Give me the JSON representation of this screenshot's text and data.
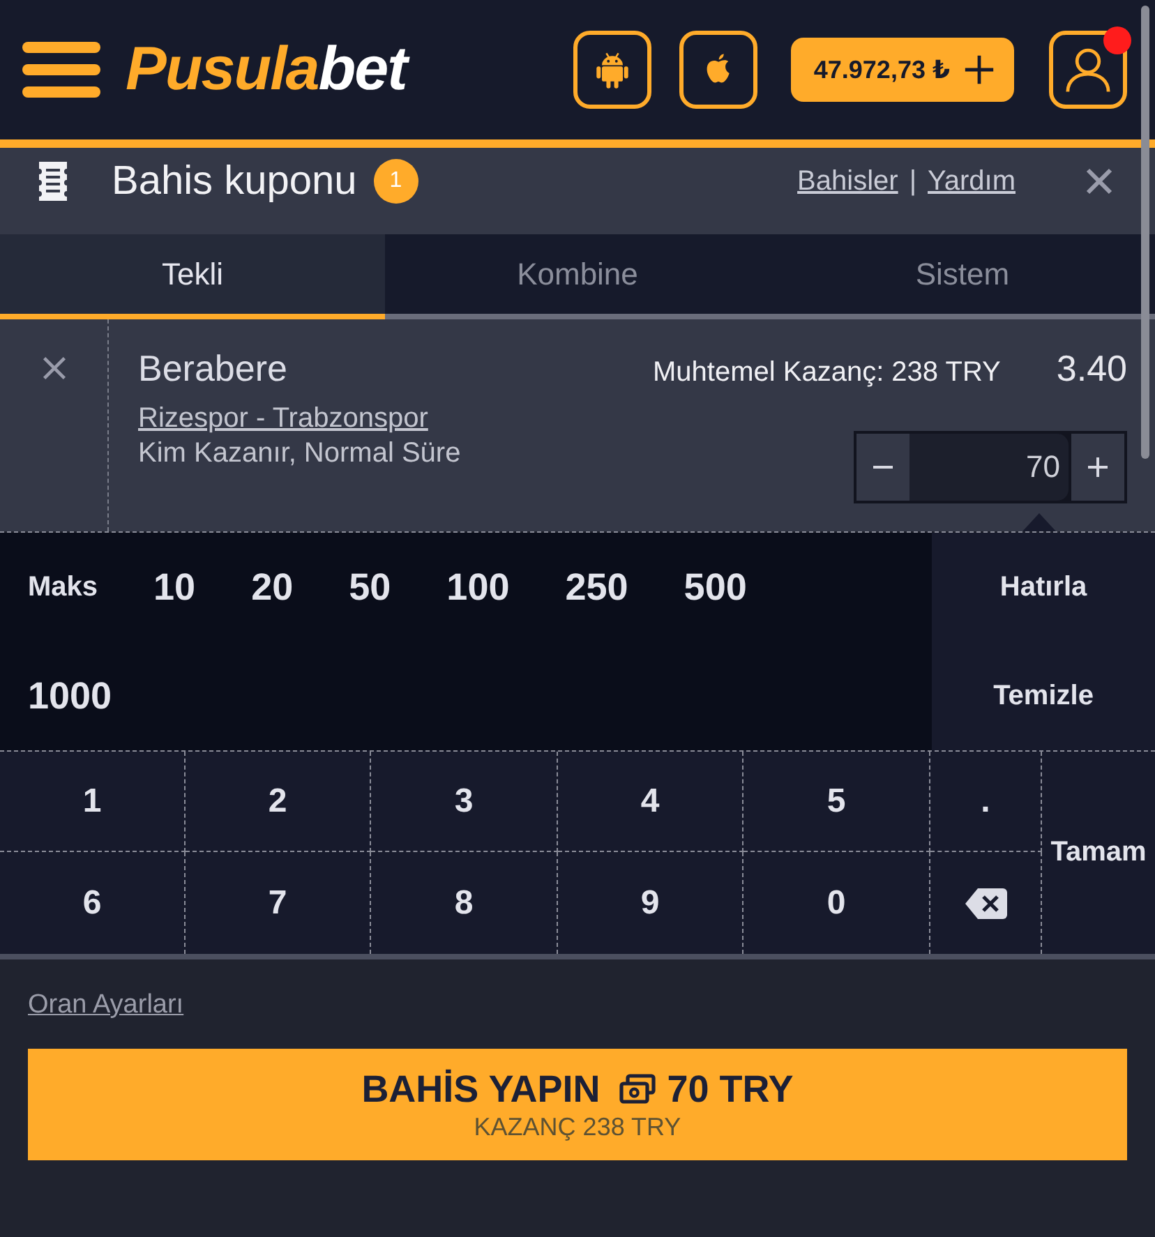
{
  "header": {
    "logo": {
      "brand_start": "Pusula",
      "brand_end": "bet"
    },
    "balance": "47.972,73 ₺",
    "profile": {
      "notification": true
    }
  },
  "coupon": {
    "title": "Bahis kuponu",
    "count": "1",
    "links": [
      {
        "label": "Bahisler"
      },
      {
        "label": "Yardım"
      }
    ],
    "separator": "|"
  },
  "tabs": [
    {
      "label": "Tekli",
      "selected": true
    },
    {
      "label": "Kombine",
      "selected": false
    },
    {
      "label": "Sistem",
      "selected": false
    }
  ],
  "bet": {
    "selection": "Berabere",
    "match": "Rizespor - Trabzonspor",
    "market": "Kim Kazanır, Normal Süre",
    "potential_win": "Muhtemel Kazanç: 238 TRY",
    "odds": "3.40",
    "stake": "70"
  },
  "keypad": {
    "quick_label": "Maks",
    "quick_amounts": [
      "10",
      "20",
      "50",
      "100",
      "250",
      "500",
      "1000"
    ],
    "actions": [
      "Hatırla",
      "Temizle"
    ],
    "keys": [
      {
        "kind": "char",
        "label": "1"
      },
      {
        "kind": "char",
        "label": "2"
      },
      {
        "kind": "char",
        "label": "3"
      },
      {
        "kind": "char",
        "label": "4"
      },
      {
        "kind": "char",
        "label": "5"
      },
      {
        "kind": "char",
        "label": "."
      },
      {
        "kind": "char",
        "label": "6"
      },
      {
        "kind": "char",
        "label": "7"
      },
      {
        "kind": "char",
        "label": "8"
      },
      {
        "kind": "char",
        "label": "9"
      },
      {
        "kind": "char",
        "label": "0"
      },
      {
        "kind": "backspace"
      }
    ],
    "done": "Tamam"
  },
  "odds_settings": "Oran Ayarları",
  "place_bet": {
    "label": "BAHİS YAPIN",
    "amount": "70 TRY",
    "winnings": "KAZANÇ 238 TRY"
  }
}
